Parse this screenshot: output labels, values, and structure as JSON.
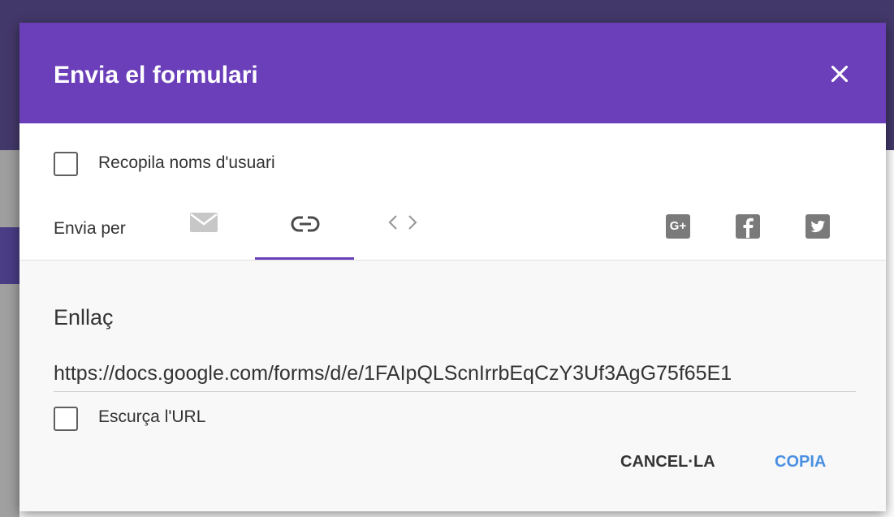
{
  "dialog": {
    "title": "Envia el formulari",
    "close_icon": "close-icon"
  },
  "options": {
    "collect_emails_label": "Recopila noms d'usuari",
    "collect_emails_checked": false
  },
  "send_via": {
    "label": "Envia per",
    "tabs": [
      {
        "icon": "email-icon",
        "selected": false
      },
      {
        "icon": "link-icon",
        "selected": true
      },
      {
        "icon": "embed-code-icon",
        "selected": false
      }
    ],
    "social": [
      {
        "icon": "google-plus-icon",
        "text": "G+"
      },
      {
        "icon": "facebook-icon"
      },
      {
        "icon": "twitter-icon"
      }
    ]
  },
  "link_panel": {
    "heading": "Enllaç",
    "url": "https://docs.google.com/forms/d/e/1FAIpQLScnIrrbEqCzY3Uf3AgG75f65E1",
    "shorten_label": "Escurça l'URL",
    "shorten_checked": false
  },
  "actions": {
    "cancel_label": "CANCEL·LA",
    "copy_label": "COPIA"
  },
  "colors": {
    "header": "#6b3fb9",
    "accent_button": "#4a90e2",
    "tab_indicator": "#6b3fb9"
  }
}
